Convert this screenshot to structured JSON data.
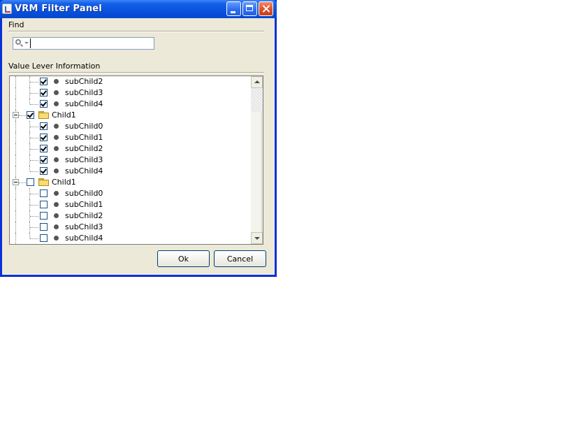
{
  "window": {
    "title": "VRM Filter Panel",
    "icon": "java-cup-icon",
    "controls": [
      "minimize-icon",
      "maximize-icon",
      "close-icon"
    ],
    "accent_color": "#0a52dc"
  },
  "find": {
    "label": "Find",
    "search": {
      "value": "",
      "placeholder": "",
      "icon": "search-icon"
    }
  },
  "value_level": {
    "label": "Value Lever Information"
  },
  "tree": {
    "rows": [
      {
        "type": "subchild",
        "label": "subChild2",
        "checked": true
      },
      {
        "type": "subchild",
        "label": "subChild3",
        "checked": true
      },
      {
        "type": "subchild",
        "label": "subChild4",
        "checked": true
      },
      {
        "type": "child",
        "label": "Child1",
        "checked": true,
        "expanded": true
      },
      {
        "type": "subchild",
        "label": "subChild0",
        "checked": true
      },
      {
        "type": "subchild",
        "label": "subChild1",
        "checked": true
      },
      {
        "type": "subchild",
        "label": "subChild2",
        "checked": true
      },
      {
        "type": "subchild",
        "label": "subChild3",
        "checked": true
      },
      {
        "type": "subchild",
        "label": "subChild4",
        "checked": true
      },
      {
        "type": "child",
        "label": "Child1",
        "checked": false,
        "expanded": true
      },
      {
        "type": "subchild",
        "label": "subChild0",
        "checked": false
      },
      {
        "type": "subchild",
        "label": "subChild1",
        "checked": false
      },
      {
        "type": "subchild",
        "label": "subChild2",
        "checked": false
      },
      {
        "type": "subchild",
        "label": "subChild3",
        "checked": false
      },
      {
        "type": "subchild",
        "label": "subChild4",
        "checked": false
      }
    ]
  },
  "buttons": {
    "ok_label": "Ok",
    "cancel_label": "Cancel"
  }
}
